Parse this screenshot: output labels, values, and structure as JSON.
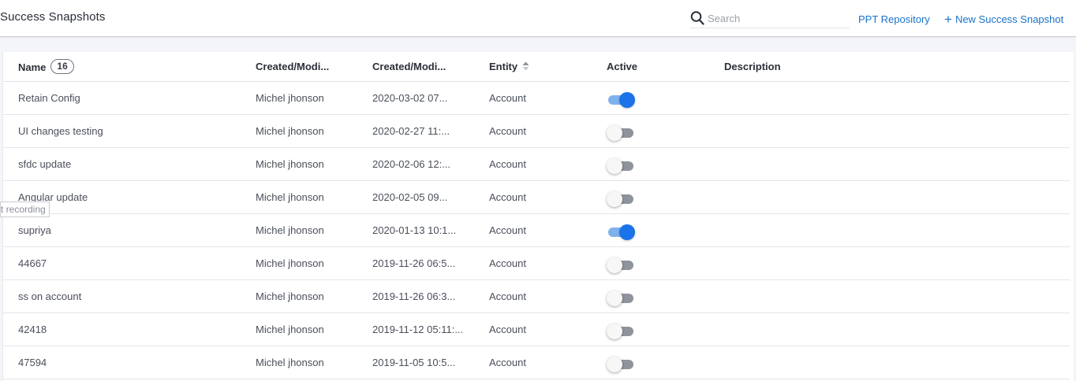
{
  "header": {
    "title": "Success Snapshots",
    "search_placeholder": "Search",
    "ppt_link": "PPT Repository",
    "new_link": "New Success Snapshot"
  },
  "table": {
    "columns": {
      "name": "Name",
      "name_count": "16",
      "created_by": "Created/Modi...",
      "created_date": "Created/Modi...",
      "entity": "Entity",
      "active": "Active",
      "description": "Description"
    },
    "rows": [
      {
        "name": "Retain Config",
        "by": "Michel jhonson",
        "date": "2020-03-02 07...",
        "entity": "Account",
        "active": true,
        "description": ""
      },
      {
        "name": "UI changes testing",
        "by": "Michel jhonson",
        "date": "2020-02-27 11:...",
        "entity": "Account",
        "active": false,
        "description": ""
      },
      {
        "name": "sfdc update",
        "by": "Michel jhonson",
        "date": "2020-02-06 12:...",
        "entity": "Account",
        "active": false,
        "description": ""
      },
      {
        "name": "Angular update",
        "by": "Michel jhonson",
        "date": "2020-02-05 09...",
        "entity": "Account",
        "active": false,
        "description": ""
      },
      {
        "name": "supriya",
        "by": "Michel jhonson",
        "date": "2020-01-13 10:1...",
        "entity": "Account",
        "active": true,
        "description": ""
      },
      {
        "name": "44667",
        "by": "Michel jhonson",
        "date": "2019-11-26 06:5...",
        "entity": "Account",
        "active": false,
        "description": ""
      },
      {
        "name": "ss on account",
        "by": "Michel jhonson",
        "date": "2019-11-26 06:3...",
        "entity": "Account",
        "active": false,
        "description": ""
      },
      {
        "name": "42418",
        "by": "Michel jhonson",
        "date": "2019-11-12 05:11:...",
        "entity": "Account",
        "active": false,
        "description": ""
      },
      {
        "name": "47594",
        "by": "Michel jhonson",
        "date": "2019-11-05 10:5...",
        "entity": "Account",
        "active": false,
        "description": ""
      }
    ]
  },
  "tooltip": {
    "text": "t recording"
  },
  "colors": {
    "accent": "#1a73e8",
    "link": "#1a73c8",
    "toggle_off": "#8e939c"
  },
  "icons": {
    "search": "search-icon",
    "plus": "plus-icon",
    "sort": "sort-icon"
  }
}
